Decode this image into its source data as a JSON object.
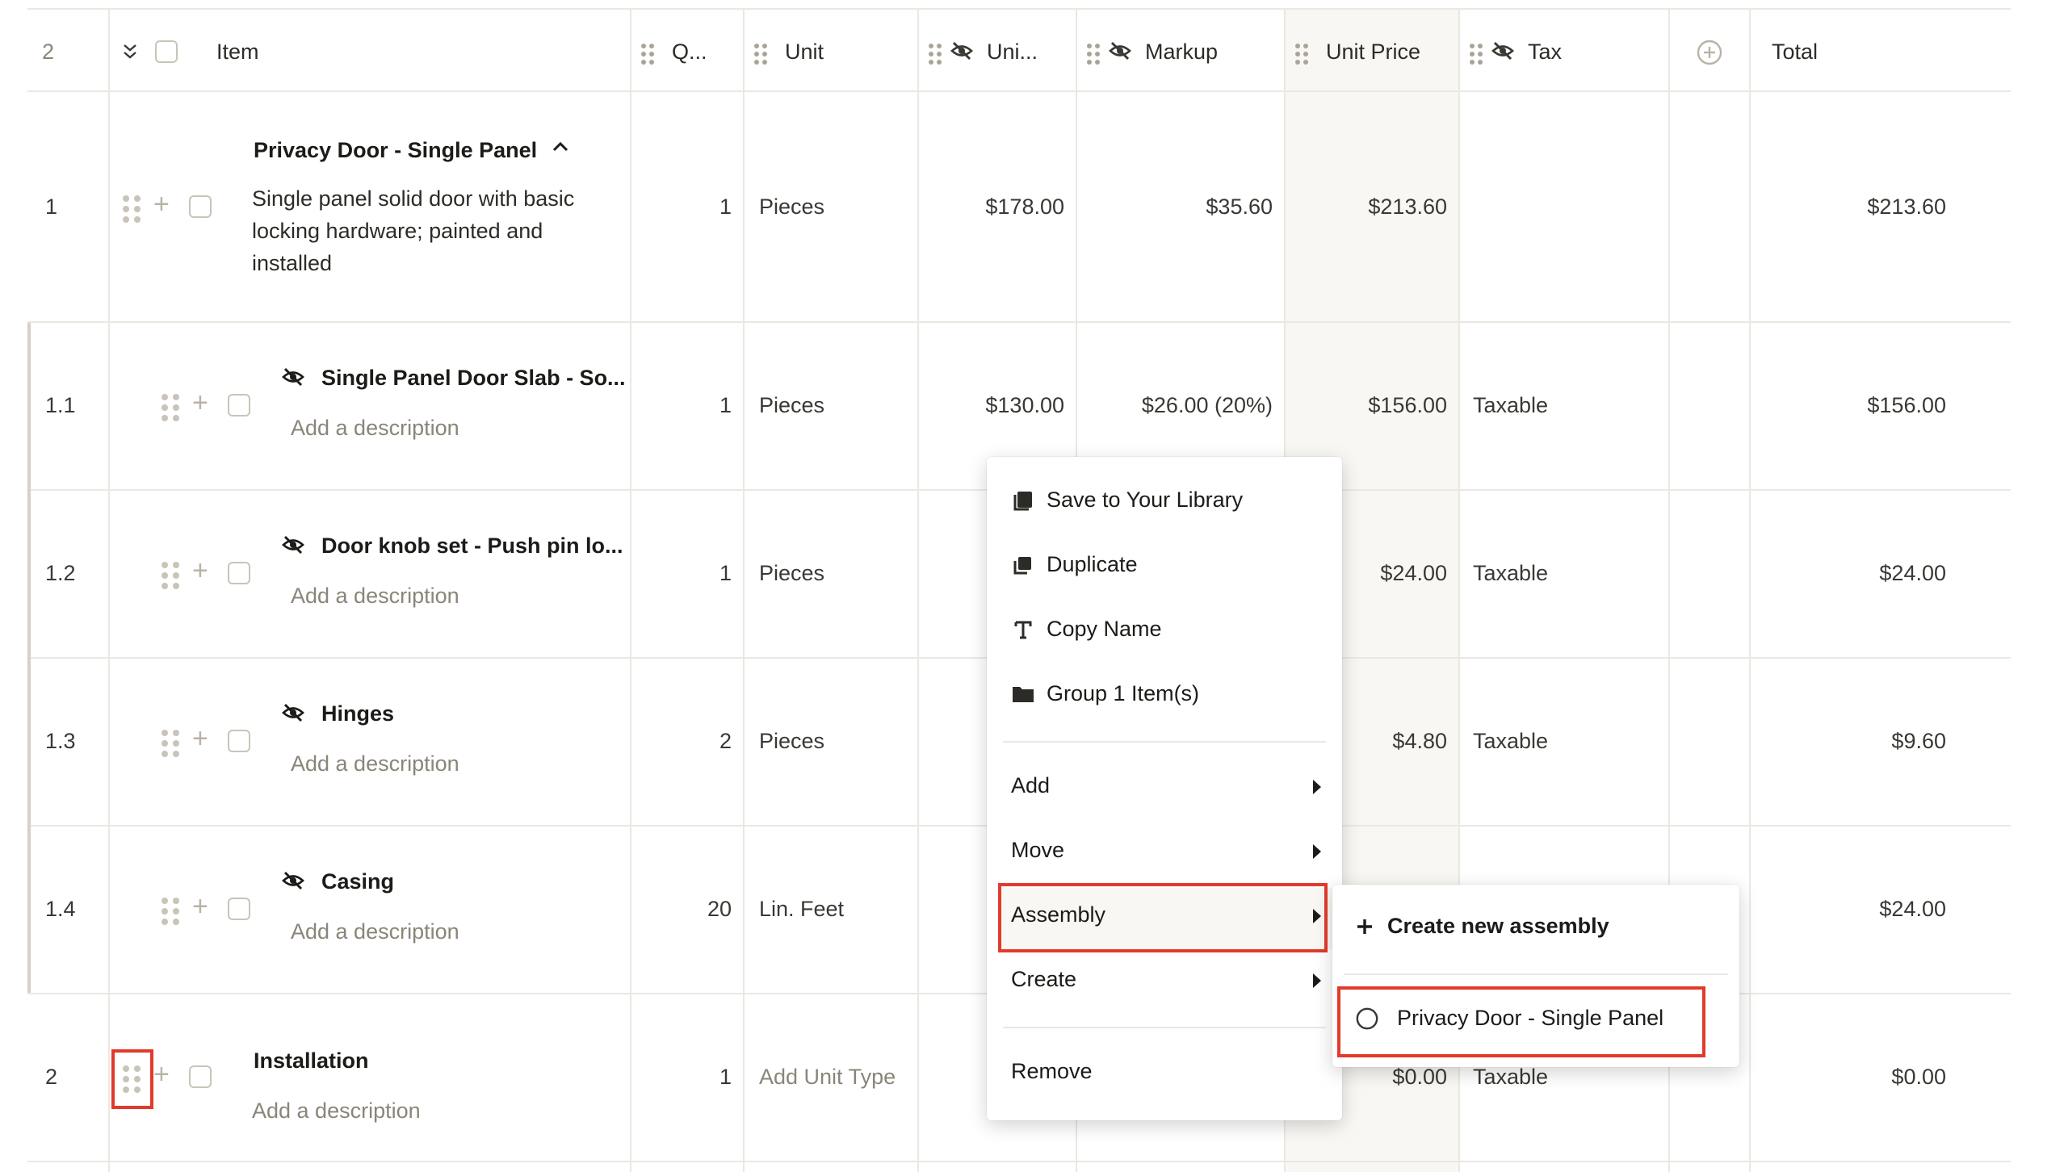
{
  "header": {
    "row_count": "2",
    "item": "Item",
    "qty": "Q...",
    "unit": "Unit",
    "unit_cost": "Uni...",
    "markup": "Markup",
    "unit_price": "Unit Price",
    "tax": "Tax",
    "total": "Total"
  },
  "rows": [
    {
      "no": "1",
      "title": "Privacy Door - Single Panel",
      "desc_lines": [
        "Single panel solid door with basic",
        "locking hardware; painted and",
        "installed"
      ],
      "qty": "1",
      "unit": "Pieces",
      "unit_cost": "$178.00",
      "markup": "$35.60",
      "unit_price": "$213.60",
      "tax": "",
      "total": "$213.60"
    },
    {
      "no": "1.1",
      "title": "Single Panel Door Slab - So...",
      "desc": "Add a description",
      "qty": "1",
      "unit": "Pieces",
      "unit_cost": "$130.00",
      "markup": "$26.00 (20%)",
      "unit_price": "$156.00",
      "tax": "Taxable",
      "total": "$156.00"
    },
    {
      "no": "1.2",
      "title": "Door knob set - Push pin lo...",
      "desc": "Add a description",
      "qty": "1",
      "unit": "Pieces",
      "unit_price": "$24.00",
      "tax": "Taxable",
      "total": "$24.00"
    },
    {
      "no": "1.3",
      "title": "Hinges",
      "desc": "Add a description",
      "qty": "2",
      "unit": "Pieces",
      "unit_price": "$4.80",
      "tax": "Taxable",
      "total": "$9.60"
    },
    {
      "no": "1.4",
      "title": "Casing",
      "desc": "Add a description",
      "qty": "20",
      "unit": "Lin. Feet",
      "total": "$24.00"
    },
    {
      "no": "2",
      "title": "Installation",
      "desc": "Add a description",
      "qty": "1",
      "unit": "Add Unit Type",
      "unit_price": "$0.00",
      "tax": "Taxable",
      "total": "$0.00"
    }
  ],
  "context_menu": {
    "save_library": "Save to Your Library",
    "duplicate": "Duplicate",
    "copy_name": "Copy Name",
    "group": "Group 1 Item(s)",
    "add": "Add",
    "move": "Move",
    "assembly": "Assembly",
    "create": "Create",
    "remove": "Remove"
  },
  "submenu": {
    "create_new": "Create new assembly",
    "option": "Privacy Door - Single Panel"
  },
  "colors": {
    "highlight": "#e23a2b",
    "grid": "#ebe8e1",
    "shade": "#f8f7f3"
  }
}
